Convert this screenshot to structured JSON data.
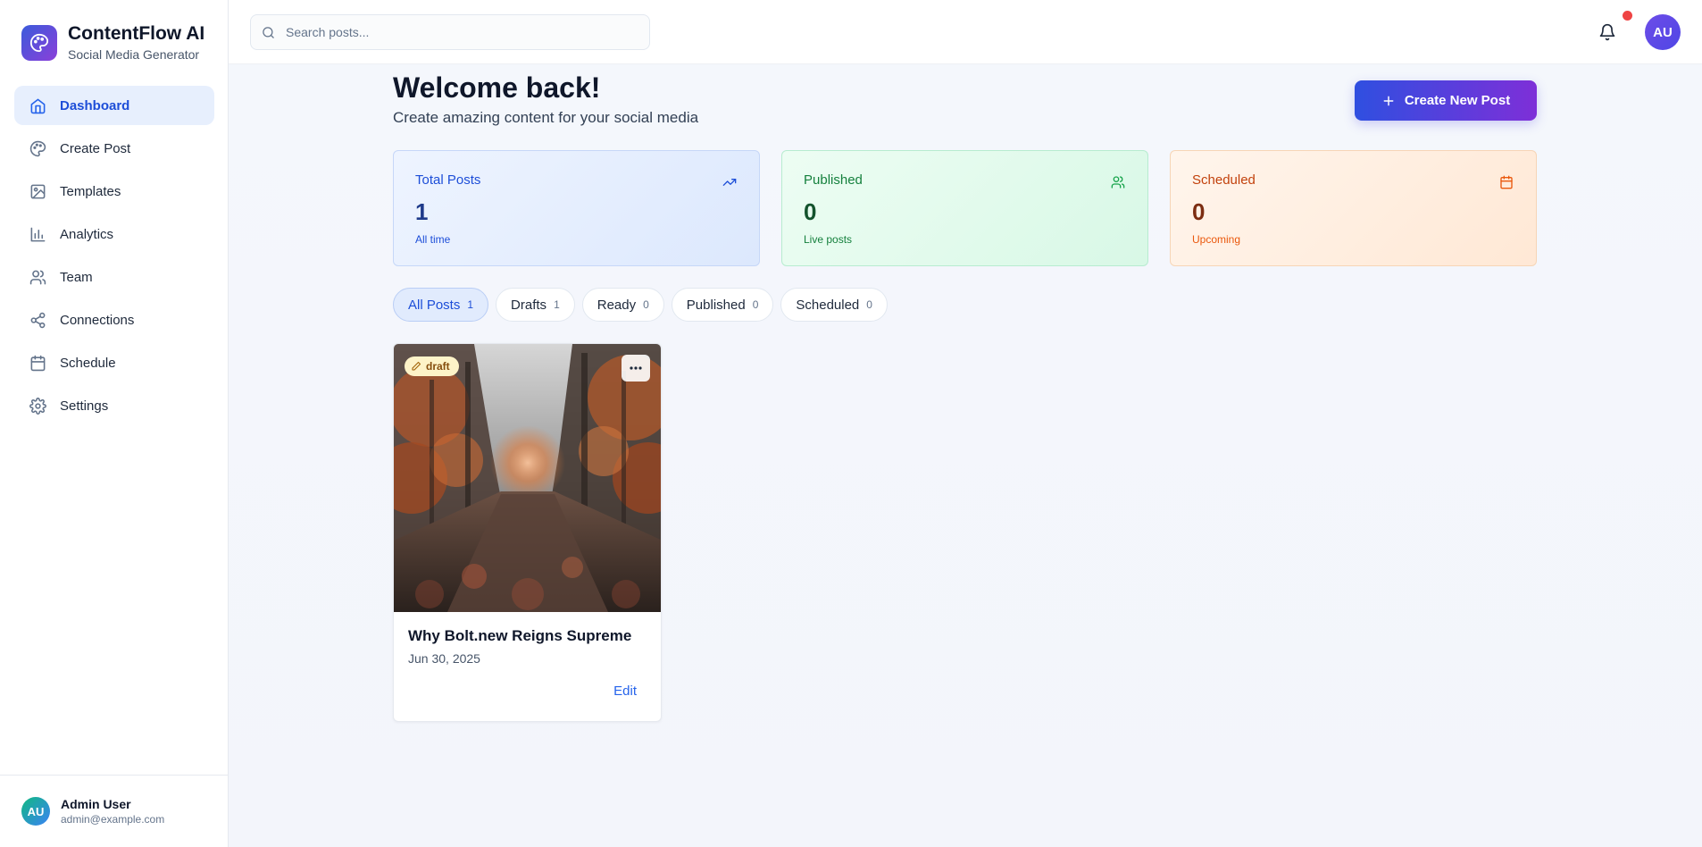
{
  "brand": {
    "title": "ContentFlow AI",
    "subtitle": "Social Media Generator"
  },
  "sidebar": {
    "items": [
      {
        "label": "Dashboard",
        "icon": "home-icon",
        "active": true
      },
      {
        "label": "Create Post",
        "icon": "palette-icon"
      },
      {
        "label": "Templates",
        "icon": "image-icon"
      },
      {
        "label": "Analytics",
        "icon": "bar-chart-icon"
      },
      {
        "label": "Team",
        "icon": "users-icon"
      },
      {
        "label": "Connections",
        "icon": "share-icon"
      },
      {
        "label": "Schedule",
        "icon": "calendar-icon"
      },
      {
        "label": "Settings",
        "icon": "gear-icon"
      }
    ],
    "user": {
      "initials": "AU",
      "name": "Admin User",
      "email": "admin@example.com"
    }
  },
  "topbar": {
    "search_placeholder": "Search posts...",
    "avatar_initials": "AU",
    "has_notification": true
  },
  "main": {
    "title": "Welcome back!",
    "subtitle": "Create amazing content for your social media",
    "create_button": "Create New Post",
    "stats": [
      {
        "label": "Total Posts",
        "value": "1",
        "sub": "All time",
        "icon": "trending-up-icon"
      },
      {
        "label": "Published",
        "value": "0",
        "sub": "Live posts",
        "icon": "users-icon"
      },
      {
        "label": "Scheduled",
        "value": "0",
        "sub": "Upcoming",
        "icon": "calendar-icon"
      }
    ],
    "tabs": [
      {
        "label": "All Posts",
        "count": "1",
        "active": true
      },
      {
        "label": "Drafts",
        "count": "1"
      },
      {
        "label": "Ready",
        "count": "0"
      },
      {
        "label": "Published",
        "count": "0"
      },
      {
        "label": "Scheduled",
        "count": "0"
      }
    ],
    "posts": [
      {
        "status": "draft",
        "title": "Why Bolt.new Reigns Supreme",
        "date": "Jun 30, 2025",
        "edit_label": "Edit"
      }
    ]
  },
  "colors": {
    "accent": "#2563eb",
    "brand_gradient_start": "#2f4fe0",
    "brand_gradient_end": "#7e2fd8",
    "notification": "#ef4444"
  }
}
